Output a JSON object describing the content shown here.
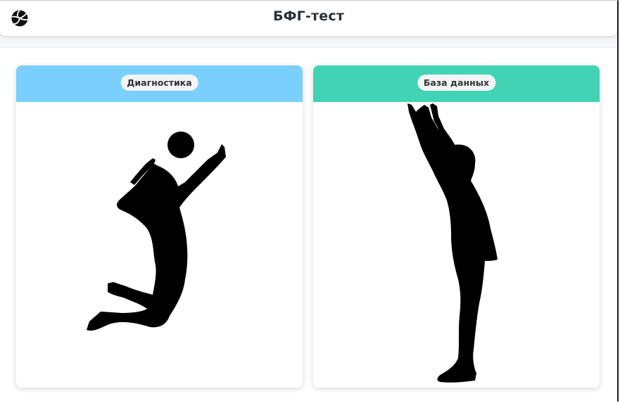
{
  "header": {
    "title": "БФГ-тест",
    "logo_icon": "volleyball-icon"
  },
  "cards": [
    {
      "label": "Диагностика",
      "accent_color": "#7acfff",
      "illustration": "volleyball-spike-silhouette"
    },
    {
      "label": "База данных",
      "accent_color": "#42d3b4",
      "illustration": "volleyball-block-silhouette"
    }
  ]
}
